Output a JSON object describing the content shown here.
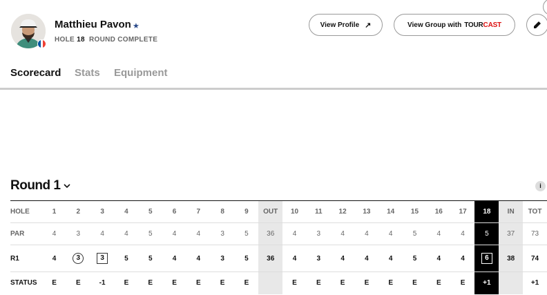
{
  "player": {
    "name": "Matthieu Pavon",
    "favorite_icon": "star-icon",
    "hole_label": "HOLE",
    "hole": "18",
    "status": "ROUND COMPLETE",
    "flag_colors": [
      "#0055a4",
      "#ffffff",
      "#ef4135"
    ]
  },
  "actions": {
    "view_profile": "View Profile",
    "view_group_prefix": "View Group with",
    "tour": "TOUR",
    "cast": "CAST",
    "round_icon": "pencil-icon"
  },
  "tabs": [
    {
      "label": "Scorecard",
      "active": true
    },
    {
      "label": "Stats",
      "active": false
    },
    {
      "label": "Equipment",
      "active": false
    }
  ],
  "round": {
    "title": "Round 1",
    "info": "i"
  },
  "scorecard": {
    "labels": {
      "hole": "HOLE",
      "par": "PAR",
      "r1": "R1",
      "status": "STATUS"
    },
    "holes": [
      "1",
      "2",
      "3",
      "4",
      "5",
      "6",
      "7",
      "8",
      "9",
      "OUT",
      "10",
      "11",
      "12",
      "13",
      "14",
      "15",
      "16",
      "17",
      "18",
      "IN",
      "TOT"
    ],
    "par": [
      "4",
      "3",
      "4",
      "4",
      "5",
      "4",
      "4",
      "3",
      "5",
      "36",
      "4",
      "3",
      "4",
      "4",
      "4",
      "5",
      "4",
      "4",
      "5",
      "37",
      "73"
    ],
    "r1": [
      "4",
      "3",
      "3",
      "5",
      "5",
      "4",
      "4",
      "3",
      "5",
      "36",
      "4",
      "3",
      "4",
      "4",
      "4",
      "5",
      "4",
      "4",
      "6",
      "38",
      "74"
    ],
    "status": [
      "E",
      "E",
      "-1",
      "E",
      "E",
      "E",
      "E",
      "E",
      "E",
      "",
      "E",
      "E",
      "E",
      "E",
      "E",
      "E",
      "E",
      "E",
      "+1",
      "",
      "+1"
    ],
    "marks": {
      "2": "birdie",
      "3": "bogey",
      "18": "bogey"
    },
    "current_hole_index": 18,
    "accent_current": "#000000",
    "accent_subtotal": "#e8e8e8"
  }
}
